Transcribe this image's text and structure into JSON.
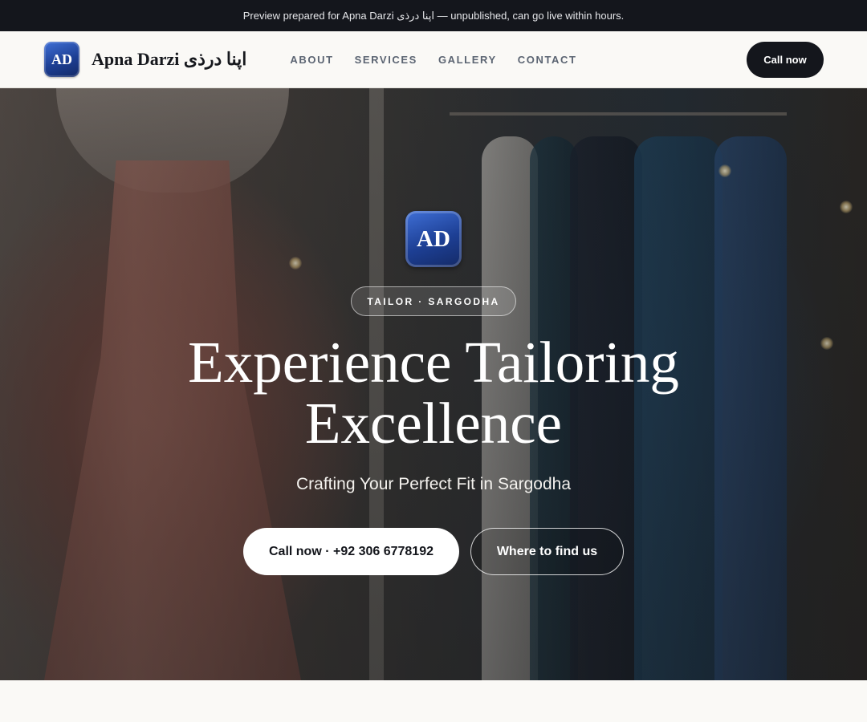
{
  "preview_banner": {
    "text": "Preview prepared for Apna Darzi اپنا درذی — unpublished, can go live within hours."
  },
  "nav": {
    "logo_initials": "AD",
    "brand_name": "Apna Darzi اپنا درذی",
    "links": [
      "ABOUT",
      "SERVICES",
      "GALLERY",
      "CONTACT"
    ],
    "call_label": "Call now"
  },
  "hero": {
    "logo_initials": "AD",
    "badge": "TAILOR · SARGODHA",
    "title_line1": "Experience Tailoring",
    "title_line2": "Excellence",
    "subtitle": "Crafting Your Perfect Fit in Sargodha",
    "primary_button": "Call now · +92 306 6778192",
    "secondary_button": "Where to find us",
    "background_image": "mannequin-dress-and-clothing-rack-photo"
  },
  "colors": {
    "dark": "#14161c",
    "page_bg": "#faf9f6",
    "logo_blue": "#1d3f94",
    "nav_link": "#5b6472"
  }
}
